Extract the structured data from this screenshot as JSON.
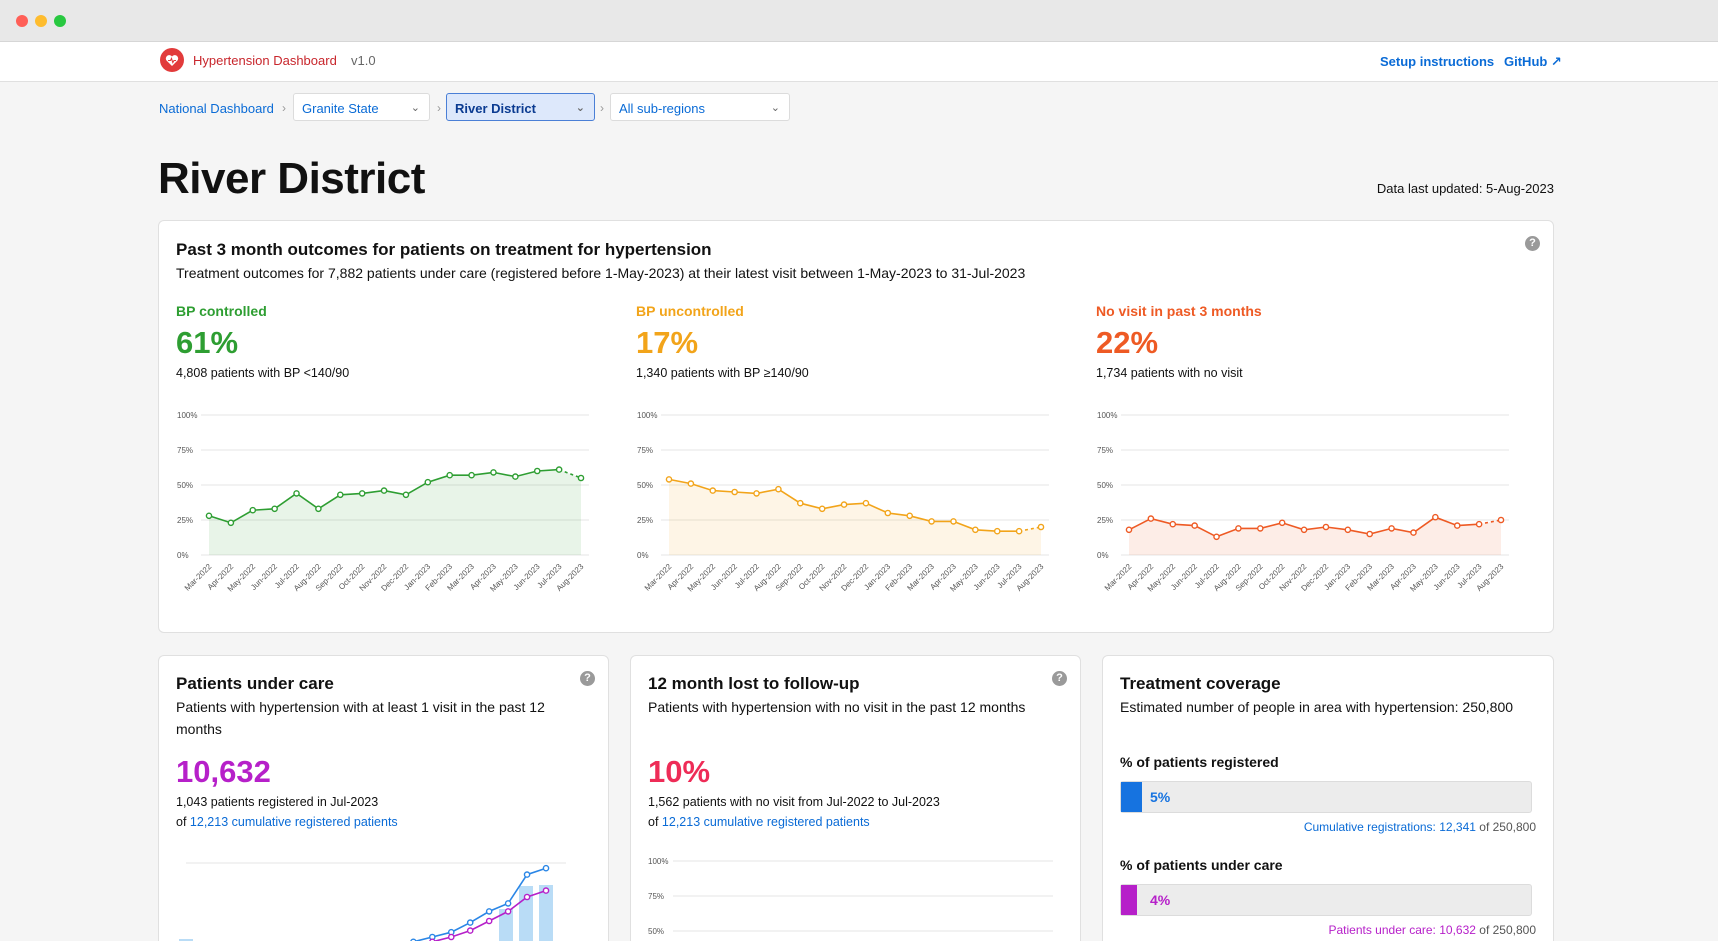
{
  "app": {
    "name": "Hypertension Dashboard",
    "version": "v1.0",
    "links": {
      "setup": "Setup instructions",
      "github": "GitHub ↗"
    }
  },
  "breadcrumb": {
    "national": "National Dashboard",
    "state": "Granite State",
    "district": "River District",
    "subregion": "All sub-regions"
  },
  "page": {
    "title": "River District",
    "updated": "Data last updated: 5-Aug-2023"
  },
  "outcomes": {
    "title": "Past 3 month outcomes for patients on treatment for hypertension",
    "subtitle": "Treatment outcomes for 7,882 patients under care (registered before 1-May-2023) at their latest visit between 1-May-2023 to 31-Jul-2023",
    "months": [
      "Mar-2022",
      "Apr-2022",
      "May-2022",
      "Jun-2022",
      "Jul-2022",
      "Aug-2022",
      "Sep-2022",
      "Oct-2022",
      "Nov-2022",
      "Dec-2022",
      "Jan-2023",
      "Feb-2023",
      "Mar-2023",
      "Apr-2023",
      "May-2023",
      "Jun-2023",
      "Jul-2023",
      "Aug-2023"
    ],
    "yticks": [
      "100%",
      "75%",
      "50%",
      "25%",
      "0%"
    ],
    "metrics": [
      {
        "label": "BP controlled",
        "value": "61%",
        "desc": "4,808 patients with BP <140/90",
        "color": "#2e9e32"
      },
      {
        "label": "BP uncontrolled",
        "value": "17%",
        "desc": "1,340 patients with BP ≥140/90",
        "color": "#f2a41a"
      },
      {
        "label": "No visit in past 3 months",
        "value": "22%",
        "desc": "1,734 patients with no visit",
        "color": "#ee5a24"
      }
    ]
  },
  "chart_data": [
    {
      "type": "area",
      "name": "BP controlled",
      "x": [
        "Mar-2022",
        "Apr-2022",
        "May-2022",
        "Jun-2022",
        "Jul-2022",
        "Aug-2022",
        "Sep-2022",
        "Oct-2022",
        "Nov-2022",
        "Dec-2022",
        "Jan-2023",
        "Feb-2023",
        "Mar-2023",
        "Apr-2023",
        "May-2023",
        "Jun-2023",
        "Jul-2023",
        "Aug-2023"
      ],
      "values": [
        28,
        23,
        32,
        33,
        44,
        33,
        43,
        44,
        46,
        43,
        52,
        57,
        57,
        59,
        56,
        60,
        61,
        55
      ],
      "ylim": [
        0,
        100
      ]
    },
    {
      "type": "area",
      "name": "BP uncontrolled",
      "x": [
        "Mar-2022",
        "Apr-2022",
        "May-2022",
        "Jun-2022",
        "Jul-2022",
        "Aug-2022",
        "Sep-2022",
        "Oct-2022",
        "Nov-2022",
        "Dec-2022",
        "Jan-2023",
        "Feb-2023",
        "Mar-2023",
        "Apr-2023",
        "May-2023",
        "Jun-2023",
        "Jul-2023",
        "Aug-2023"
      ],
      "values": [
        54,
        51,
        46,
        45,
        44,
        47,
        37,
        33,
        36,
        37,
        30,
        28,
        24,
        24,
        18,
        17,
        17,
        20
      ],
      "ylim": [
        0,
        100
      ]
    },
    {
      "type": "area",
      "name": "No visit in past 3 months",
      "x": [
        "Mar-2022",
        "Apr-2022",
        "May-2022",
        "Jun-2022",
        "Jul-2022",
        "Aug-2022",
        "Sep-2022",
        "Oct-2022",
        "Nov-2022",
        "Dec-2022",
        "Jan-2023",
        "Feb-2023",
        "Mar-2023",
        "Apr-2023",
        "May-2023",
        "Jun-2023",
        "Jul-2023",
        "Aug-2023"
      ],
      "values": [
        18,
        26,
        22,
        21,
        13,
        19,
        19,
        23,
        18,
        20,
        18,
        15,
        19,
        16,
        27,
        21,
        22,
        25
      ],
      "ylim": [
        0,
        100
      ]
    },
    {
      "type": "bar+line",
      "name": "Patients under care",
      "bars": [
        22,
        0,
        0,
        0,
        10,
        0,
        0,
        0,
        0,
        0,
        0,
        0,
        0,
        0,
        18,
        0,
        52,
        75,
        76
      ],
      "lines": [
        [
          0,
          0,
          0,
          0,
          0,
          0,
          0,
          0,
          2,
          4,
          6,
          8,
          12,
          15,
          18,
          24,
          31,
          36,
          54,
          58
        ],
        [
          0,
          0,
          0,
          0,
          0,
          0,
          0,
          0,
          1,
          2,
          3,
          5,
          9,
          12,
          15,
          19,
          25,
          31,
          40,
          44
        ]
      ]
    },
    {
      "type": "line",
      "name": "12 month lost to follow-up",
      "yticks": [
        "100%",
        "75%",
        "50%"
      ]
    }
  ],
  "under_care": {
    "title": "Patients under care",
    "subtitle": "Patients with hypertension with at least 1 visit in the past 12 months",
    "value": "10,632",
    "line1": "1,043 patients registered in Jul-2023",
    "of": "of",
    "link": "12,213 cumulative registered patients",
    "color": "#b620c9"
  },
  "lost": {
    "title": "12 month lost to follow-up",
    "subtitle": "Patients with hypertension with no visit in the past 12 months",
    "value": "10%",
    "line1": "1,562 patients with no visit from Jul-2022 to Jul-2023",
    "of": "of",
    "link": "12,213 cumulative registered patients",
    "yticks": [
      "100%",
      "75%",
      "50%"
    ],
    "color": "#ee2c57"
  },
  "coverage": {
    "title": "Treatment coverage",
    "subtitle": "Estimated number of people in area with hypertension: 250,800",
    "registered_label": "% of patients registered",
    "registered_pct": "5%",
    "registered_frac": 0.05,
    "registered_note_label": "Cumulative registrations:",
    "registered_note_value": "12,341",
    "under_care_label": "% of patients under care",
    "under_care_pct": "4%",
    "under_care_frac": 0.04,
    "under_care_note_label": "Patients under care:",
    "under_care_note_value": "10,632",
    "of_total": "of 250,800"
  }
}
